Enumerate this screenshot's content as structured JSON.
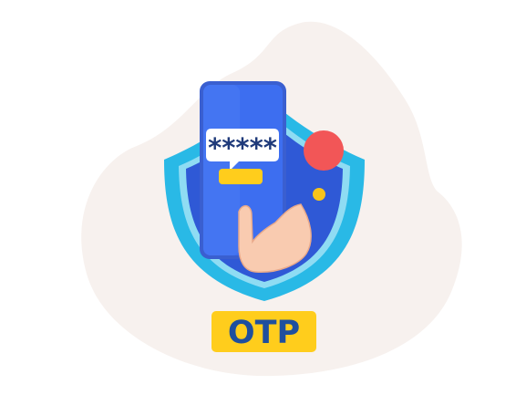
{
  "illustration": {
    "password_mask": "*****",
    "badge_label": "OTP",
    "colors": {
      "background_blob": "#f7f1ee",
      "shield_outer": "#29b9e6",
      "shield_inner": "#2f59d6",
      "phone_body": "#3d6ef0",
      "phone_frame": "#3a5fd0",
      "chat_bubble": "#ffffff",
      "button": "#ffcd1c",
      "badge": "#ffcd1c",
      "badge_text": "#1f4f9e",
      "red_dot": "#f25657",
      "yellow_dot": "#f7c41a",
      "hand": "#f9cbb0"
    },
    "icons": [
      "shield-icon",
      "phone-icon",
      "chat-bubble-icon",
      "hand-icon"
    ]
  }
}
